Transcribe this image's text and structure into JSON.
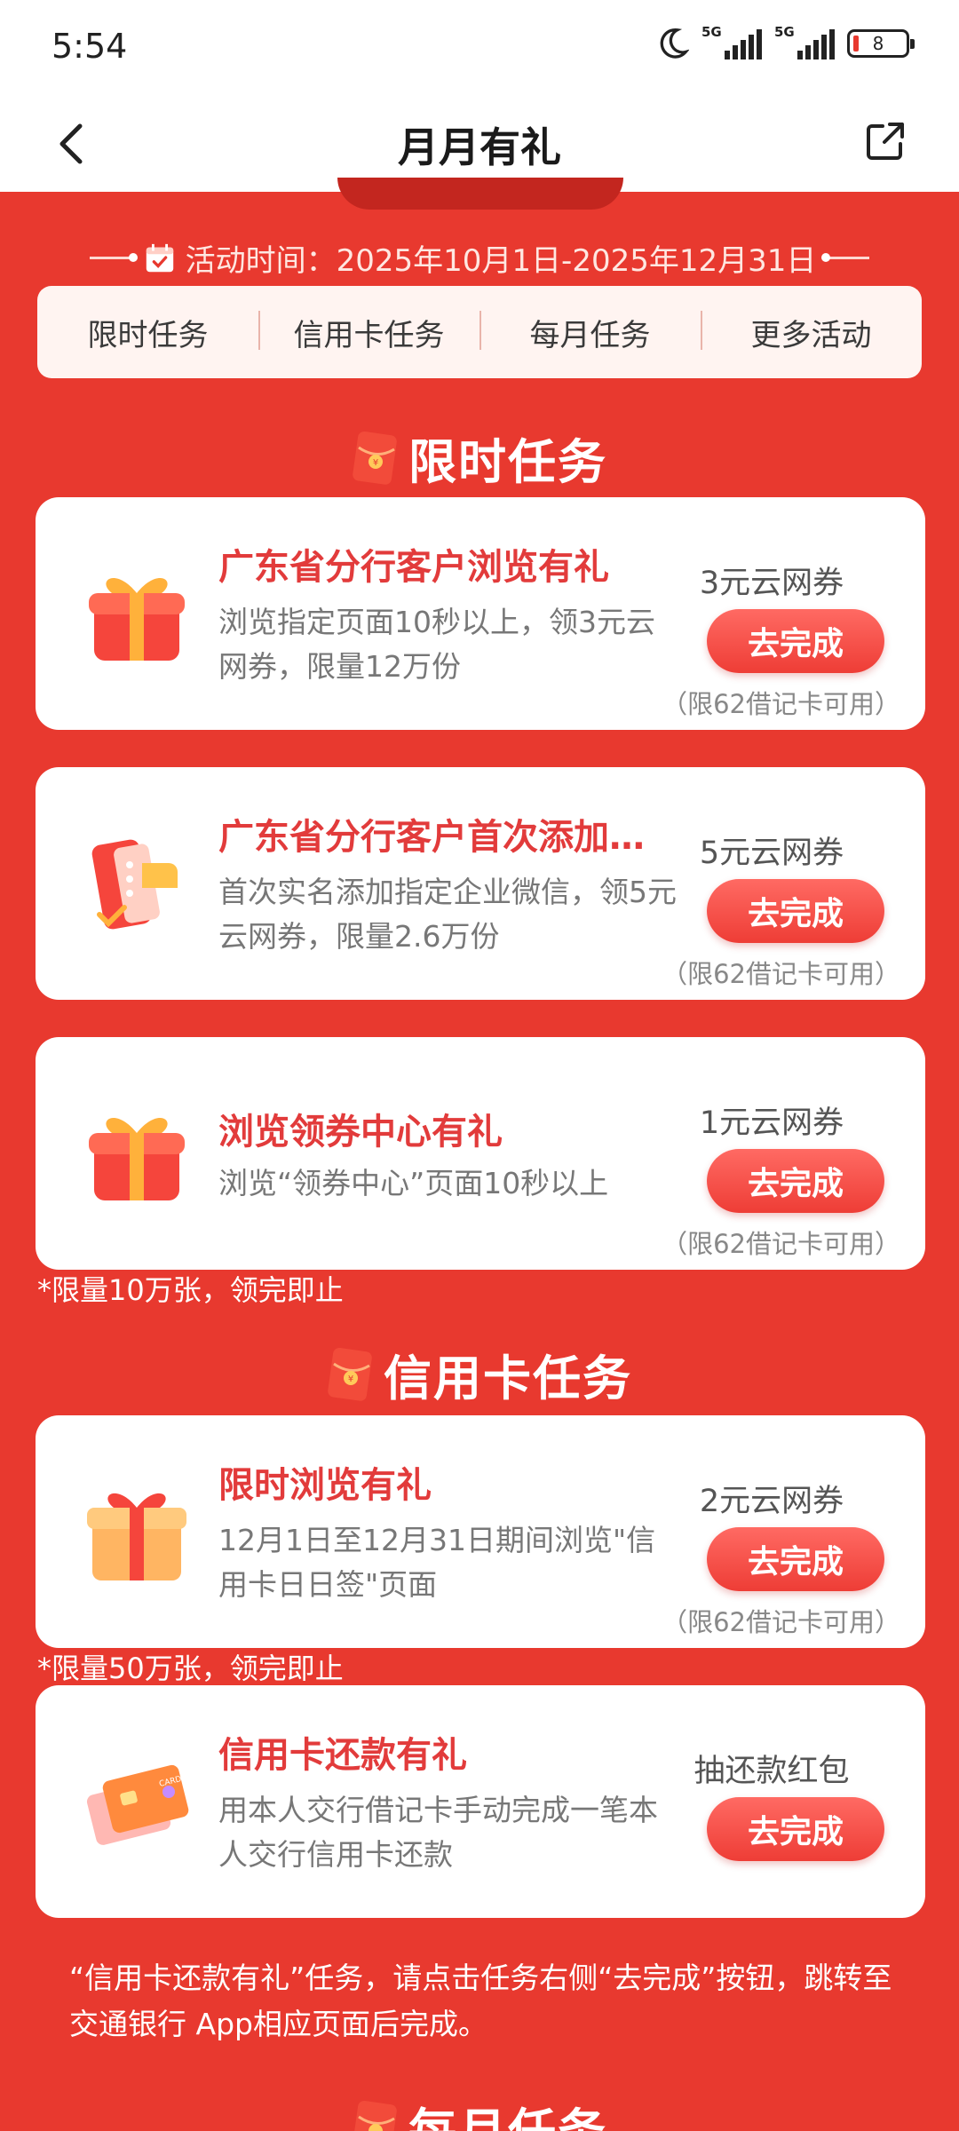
{
  "status": {
    "time": "5:54",
    "sim1": "5G",
    "sim2": "5G",
    "battery": "8"
  },
  "nav": {
    "title": "月月有礼"
  },
  "activity": {
    "time_text": "活动时间：2025年10月1日-2025年12月31日"
  },
  "tabs": [
    {
      "label": "限时任务"
    },
    {
      "label": "信用卡任务"
    },
    {
      "label": "每月任务"
    },
    {
      "label": "更多活动"
    }
  ],
  "sections": {
    "limited": {
      "title": "限时任务"
    },
    "credit": {
      "title": "信用卡任务"
    },
    "monthly": {
      "title": "每月任务"
    }
  },
  "limited_tasks": [
    {
      "title": "广东省分行客户浏览有礼",
      "desc": "浏览指定页面10秒以上，领3元云网券，限量12万份",
      "reward": "3元云网券",
      "button": "去完成",
      "note": "（限62借记卡可用）",
      "icon": "gift-box-icon"
    },
    {
      "title": "广东省分行客户首次添加…",
      "desc": "首次实名添加指定企业微信，领5元云网券，限量2.6万份",
      "reward": "5元云网券",
      "button": "去完成",
      "note": "（限62借记卡可用）",
      "icon": "phone-coupon-icon"
    },
    {
      "title": "浏览领券中心有礼",
      "desc": "浏览“领券中心”页面10秒以上",
      "reward": "1元云网券",
      "button": "去完成",
      "note": "（限62借记卡可用）",
      "icon": "gift-box-icon"
    }
  ],
  "limited_footnote": "*限量10万张，领完即止",
  "credit_tasks": [
    {
      "title": "限时浏览有礼",
      "desc": "12月1日至12月31日期间浏览\"信用卡日日签\"页面",
      "reward": "2元云网券",
      "button": "去完成",
      "note": "（限62借记卡可用）",
      "icon": "gift-box-icon"
    },
    {
      "title": "信用卡还款有礼",
      "desc": "用本人交行借记卡手动完成一笔本人交行信用卡还款",
      "reward": "抽还款红包",
      "button": "去完成",
      "icon": "credit-card-icon"
    }
  ],
  "credit_footnote": "*限量50万张，领完即止",
  "credit_remark": "“信用卡还款有礼”任务，请点击任务右侧“去完成”按钮，跳转至交通银行 App相应页面后完成。",
  "colors": {
    "background": "#e8392f",
    "accent": "#e23b3b",
    "button": "#ee3d36"
  }
}
